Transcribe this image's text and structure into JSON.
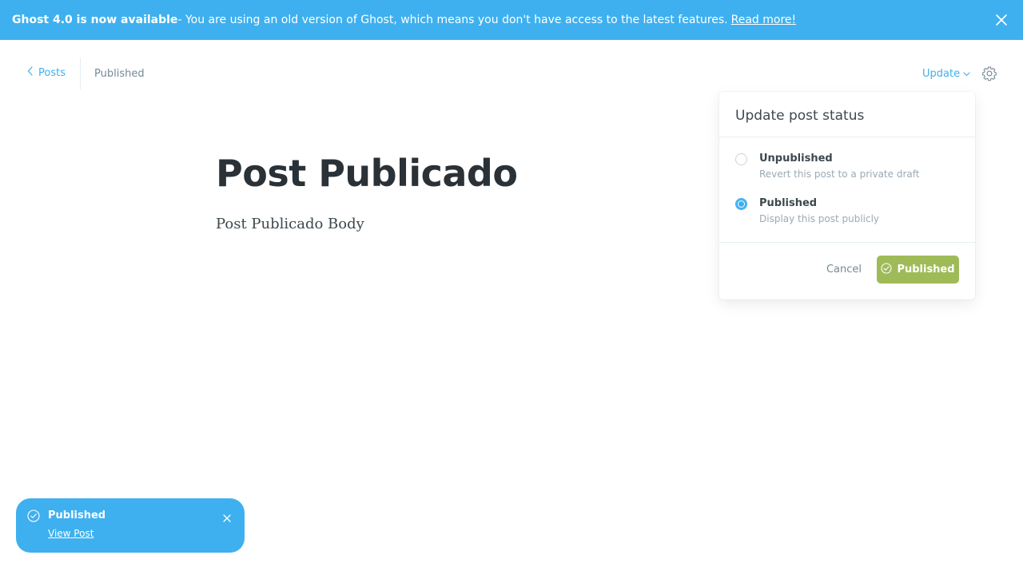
{
  "banner": {
    "strong": "Ghost 4.0 is now available",
    "message": " - You are using an old version of Ghost, which means you don't have access to the latest features.",
    "link": "Read more!"
  },
  "header": {
    "back_label": "Posts",
    "status": "Published",
    "update_label": "Update"
  },
  "post": {
    "title": "Post Publicado",
    "body": "Post Publicado Body"
  },
  "publish_menu": {
    "title": "Update post status",
    "options": [
      {
        "title": "Unpublished",
        "description": "Revert this post to a private draft",
        "selected": false
      },
      {
        "title": "Published",
        "description": "Display this post publicly",
        "selected": true
      }
    ],
    "cancel_label": "Cancel",
    "confirm_label": "Published"
  },
  "toast": {
    "title": "Published",
    "link": "View Post"
  },
  "colors": {
    "accent": "#3eb0ef",
    "success": "#9fbb58"
  }
}
